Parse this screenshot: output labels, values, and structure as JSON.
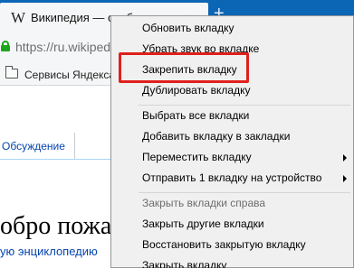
{
  "browser": {
    "tab_favicon": "W",
    "tab_title": "Википедия — свободная энциклопедия",
    "tab_close": "×",
    "new_tab": "+",
    "url": "https://ru.wikipedia.org",
    "bookmark_label": "Сервисы Яндекса"
  },
  "page": {
    "discussion_tab": "Обсуждение",
    "welcome_text": "обро пожаловать",
    "encyclopedia_link": "ую энциклопедию"
  },
  "context_menu": {
    "items": [
      {
        "label": "Обновить вкладку",
        "disabled": false
      },
      {
        "label": "Убрать звук во вкладке",
        "disabled": false
      },
      {
        "label": "Закрепить вкладку",
        "disabled": false
      },
      {
        "label": "Дублировать вкладку",
        "disabled": false
      },
      {
        "label": "Выбрать все вкладки",
        "disabled": false
      },
      {
        "label": "Добавить вкладку в закладки",
        "disabled": false
      },
      {
        "label": "Переместить вкладку",
        "disabled": false,
        "submenu": true
      },
      {
        "label": "Отправить 1 вкладку на устройство",
        "disabled": false,
        "submenu": true
      },
      {
        "label": "Закрыть вкладки справа",
        "disabled": true
      },
      {
        "label": "Закрыть другие вкладки",
        "disabled": false
      },
      {
        "label": "Восстановить закрытую вкладку",
        "disabled": false
      },
      {
        "label": "Закрыть вкладку",
        "disabled": false
      }
    ]
  },
  "colors": {
    "tabstrip": "#0b66b6",
    "menu_background": "#f0f0f0",
    "highlight_border": "#e0201b",
    "link": "#0645ad",
    "secure_lock": "#1ea51e"
  }
}
